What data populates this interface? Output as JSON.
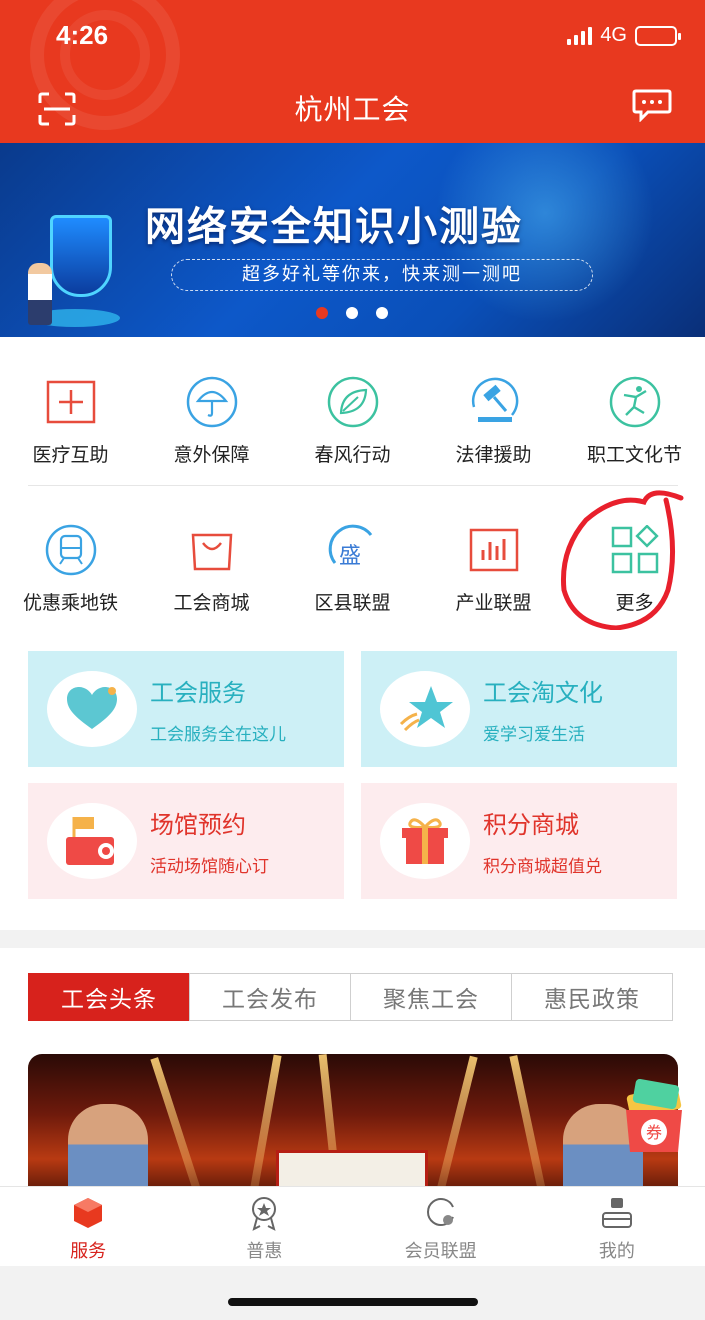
{
  "status_bar": {
    "time": "4:26",
    "network": "4G"
  },
  "header": {
    "title": "杭州工会",
    "left_icon": "scan-icon",
    "right_icon": "chat-icon"
  },
  "banner": {
    "title": "网络安全知识小测验",
    "subtitle": "超多好礼等你来，快来测一测吧",
    "slide_count": 3,
    "active_slide": 1
  },
  "services_row1": [
    {
      "label": "医疗互助",
      "icon": "medical-cross-icon"
    },
    {
      "label": "意外保障",
      "icon": "umbrella-icon"
    },
    {
      "label": "春风行动",
      "icon": "leaf-icon"
    },
    {
      "label": "法律援助",
      "icon": "gavel-icon"
    },
    {
      "label": "职工文化节",
      "icon": "dancer-icon"
    }
  ],
  "services_row2": [
    {
      "label": "优惠乘地铁",
      "icon": "metro-icon"
    },
    {
      "label": "工会商城",
      "icon": "shopping-bag-icon"
    },
    {
      "label": "区县联盟",
      "icon": "alliance-icon"
    },
    {
      "label": "产业联盟",
      "icon": "bar-chart-icon"
    },
    {
      "label": "更多",
      "icon": "grid-more-icon"
    }
  ],
  "feature_cards": [
    {
      "title": "工会服务",
      "subtitle": "工会服务全在这儿",
      "icon": "heart-icon"
    },
    {
      "title": "工会淘文化",
      "subtitle": "爱学习爱生活",
      "icon": "star-icon"
    },
    {
      "title": "场馆预约",
      "subtitle": "活动场馆随心订",
      "icon": "venue-flag-icon"
    },
    {
      "title": "积分商城",
      "subtitle": "积分商城超值兑",
      "icon": "gift-icon"
    }
  ],
  "news_tabs": [
    "工会头条",
    "工会发布",
    "聚焦工会",
    "惠民政策"
  ],
  "news_active_tab": 0,
  "floating_coupon": {
    "label": "券"
  },
  "tabbar": [
    {
      "label": "服务",
      "icon": "service-cube-icon",
      "active": true
    },
    {
      "label": "普惠",
      "icon": "medal-icon",
      "active": false
    },
    {
      "label": "会员联盟",
      "icon": "member-alliance-icon",
      "active": false
    },
    {
      "label": "我的",
      "icon": "profile-icon",
      "active": false
    }
  ],
  "colors": {
    "primary": "#e8391f",
    "tab_active": "#d7221c",
    "card_blue": "#cdf0f6",
    "card_pink": "#fdecee",
    "teal_text": "#28b0bf"
  }
}
